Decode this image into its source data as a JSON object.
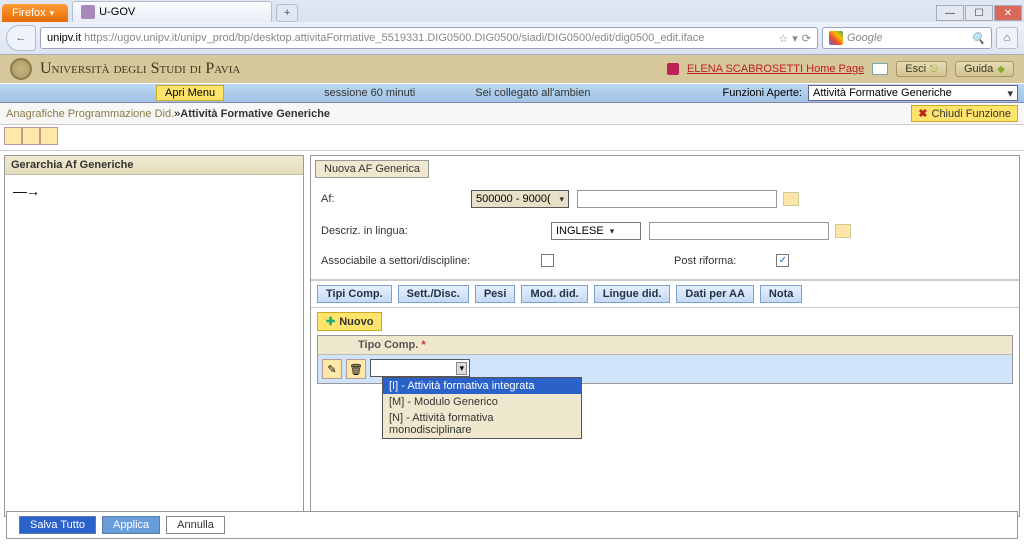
{
  "browser": {
    "firefox_label": "Firefox",
    "tab_title": "U-GOV",
    "add_tab": "+",
    "url_prefix": "unipv.it",
    "url_full": "https://ugov.unipv.it/unipv_prod/bp/desktop.attivitaFormative_5519331.DIG0500.DIG0500/siadi/DIG0500/edit/dig0500_edit.iface",
    "search_placeholder": "Google",
    "reload_glyph": "⟳",
    "star_glyph": "☆",
    "dd_glyph": "▾",
    "back_glyph": "←",
    "search_glyph": "🔍",
    "home_glyph": "⌂",
    "min_glyph": "—",
    "max_glyph": "☐",
    "close_glyph": "✕"
  },
  "header": {
    "uni_name": "Università degli Studi di Pavia",
    "user_link": "ELENA SCABROSETTI Home Page",
    "esci": "Esci",
    "guida": "Guida"
  },
  "menubar": {
    "apri_menu": "Apri Menu",
    "session": "sessione 60 minuti",
    "status": "Sei collegato all'ambien",
    "funzioni_label": "Funzioni Aperte:",
    "funzioni_value": "Attività Formative Generiche"
  },
  "crumb": {
    "a": "Anagrafiche Programmazione Did.",
    "sep": " » ",
    "b": "Attività Formative Generiche",
    "chiudi": "Chiudi Funzione"
  },
  "left": {
    "title": "Gerarchia Af Generiche",
    "arrow": "—→"
  },
  "right": {
    "nuova_btn": "Nuova AF Generica",
    "af_label": "Af:",
    "af_value": "500000 - 9000(",
    "descr_label": "Descriz. in lingua:",
    "lang_value": "INGLESE",
    "assoc_label": "Associabile a settori/discipline:",
    "post_label": "Post riforma:",
    "post_checked": "✓"
  },
  "tabs": {
    "t1": "Tipi Comp.",
    "t2": "Sett./Disc.",
    "t3": "Pesi",
    "t4": "Mod. did.",
    "t5": "Lingue did.",
    "t6": "Dati per AA",
    "t7": "Nota"
  },
  "grid": {
    "nuovo": "Nuovo",
    "col_header": "Tipo Comp.",
    "asterisk": "*",
    "edit_glyph": "✎",
    "del_glyph": "🗑",
    "opt1": "[I] - Attività formativa integrata",
    "opt2": "[M] - Modulo Generico",
    "opt3": "[N] - Attività formativa monodisciplinare"
  },
  "footer": {
    "save": "Salva Tutto",
    "apply": "Applica",
    "cancel": "Annulla"
  }
}
